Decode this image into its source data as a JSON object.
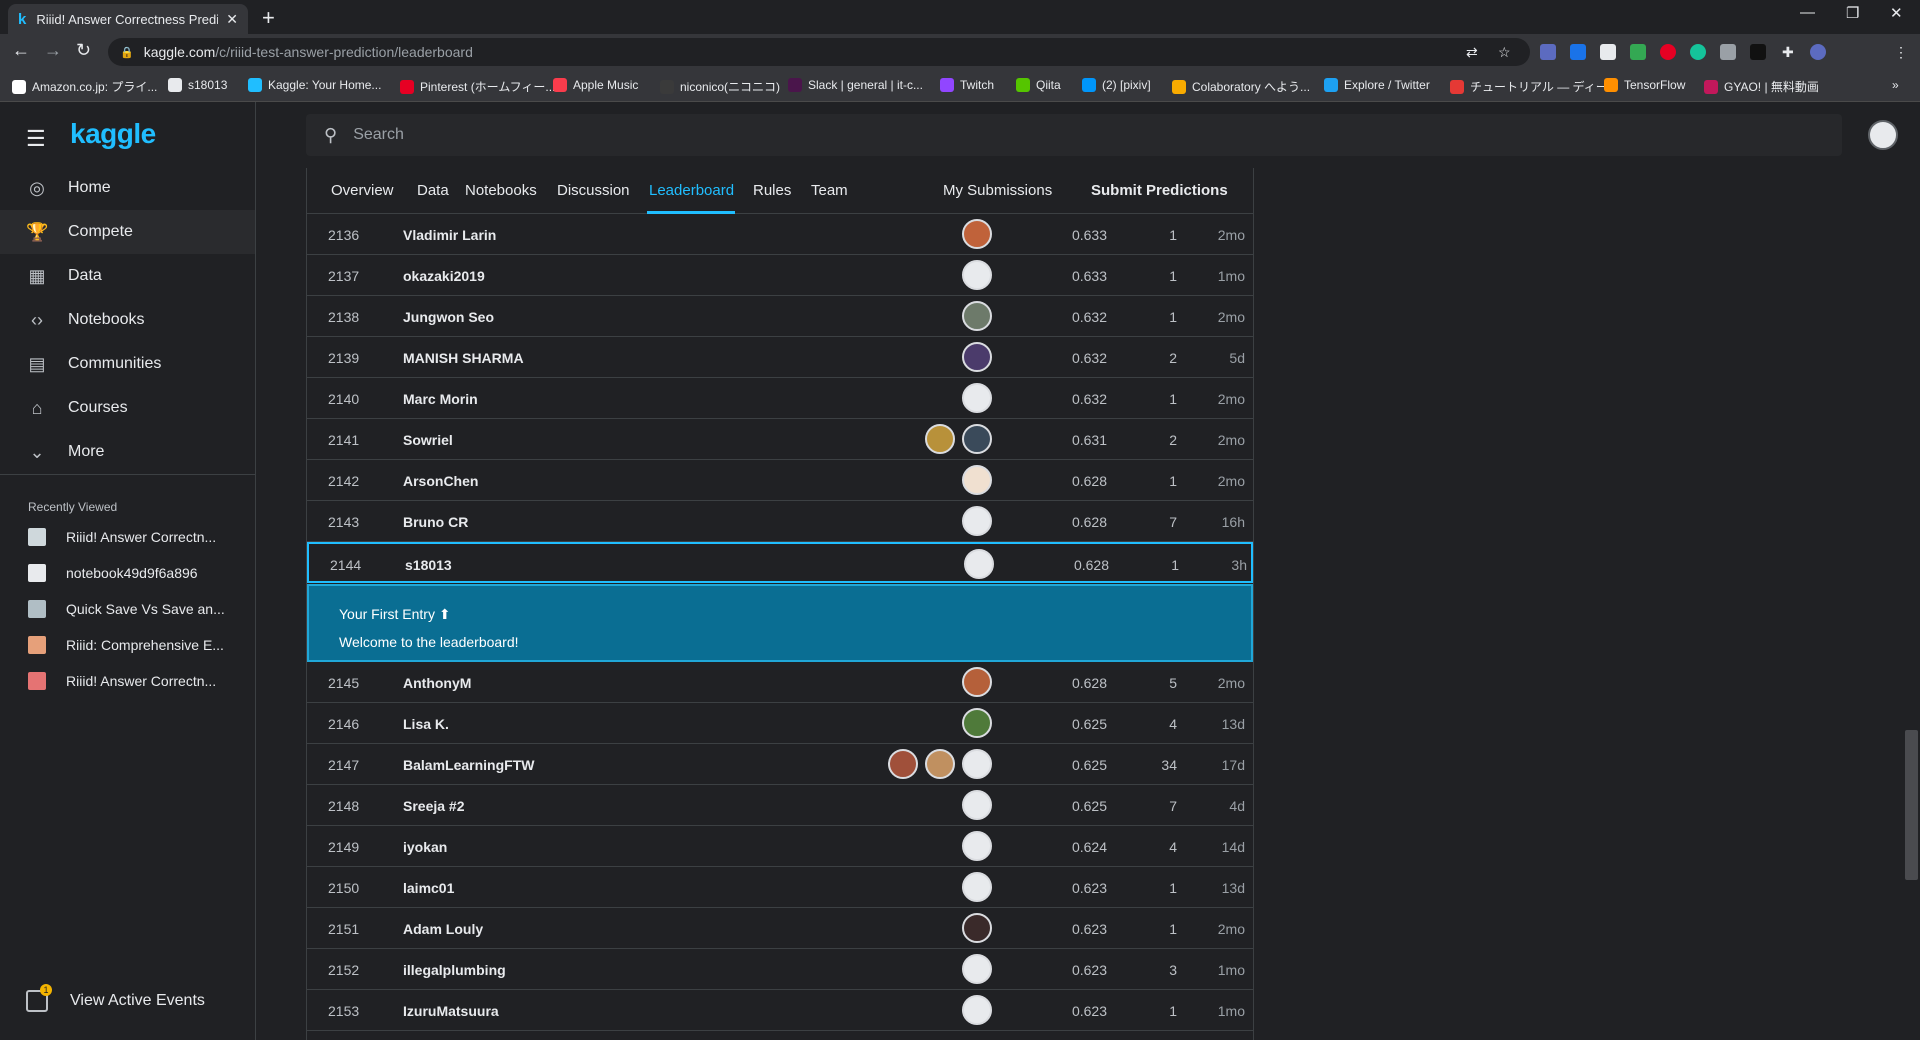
{
  "browser": {
    "tab_title": "Riiid! Answer Correctness Predicti",
    "tab_favicon": "k",
    "url_host": "kaggle.com",
    "url_path": "/c/riiid-test-answer-prediction/leaderboard",
    "bookmarks": [
      {
        "label": "Amazon.co.jp: プライ...",
        "color": "#ffffff"
      },
      {
        "label": "s18013",
        "color": "#e8eaed"
      },
      {
        "label": "Kaggle: Your Home...",
        "color": "#20beff"
      },
      {
        "label": "Pinterest (ホームフィー...",
        "color": "#e60023"
      },
      {
        "label": "Apple Music",
        "color": "#fa3c4c"
      },
      {
        "label": "niconico(ニコニコ)",
        "color": "#3a3a3a"
      },
      {
        "label": "Slack | general | it-c...",
        "color": "#4a154b"
      },
      {
        "label": "Twitch",
        "color": "#9146ff"
      },
      {
        "label": "Qiita",
        "color": "#55c500"
      },
      {
        "label": "(2) [pixiv]",
        "color": "#0096fa"
      },
      {
        "label": "Colaboratory へよう...",
        "color": "#f9ab00"
      },
      {
        "label": "Explore / Twitter",
        "color": "#1da1f2"
      },
      {
        "label": "チュートリアル — ディー...",
        "color": "#e53935"
      },
      {
        "label": "TensorFlow",
        "color": "#ff8f00"
      },
      {
        "label": "GYAO! | 無料動画",
        "color": "#c2185b"
      }
    ]
  },
  "sidebar": {
    "logo": "kaggle",
    "items": [
      {
        "label": "Home",
        "icon": "compass-icon",
        "glyph": "◎"
      },
      {
        "label": "Compete",
        "icon": "trophy-icon",
        "glyph": "🏆"
      },
      {
        "label": "Data",
        "icon": "table-icon",
        "glyph": "▦"
      },
      {
        "label": "Notebooks",
        "icon": "code-icon",
        "glyph": "‹›"
      },
      {
        "label": "Communities",
        "icon": "forum-icon",
        "glyph": "▤"
      },
      {
        "label": "Courses",
        "icon": "graduation-cap-icon",
        "glyph": "⌂"
      },
      {
        "label": "More",
        "icon": "chevron-down-icon",
        "glyph": "⌄"
      }
    ],
    "recently_viewed_title": "Recently Viewed",
    "recent": [
      {
        "label": "Riiid! Answer Correctn...",
        "color": "#cfd8dc"
      },
      {
        "label": "notebook49d9f6a896",
        "color": "#e8eaed"
      },
      {
        "label": "Quick Save Vs Save an...",
        "color": "#b0bec5"
      },
      {
        "label": "Riiid: Comprehensive E...",
        "color": "#e6a07a"
      },
      {
        "label": "Riiid! Answer Correctn...",
        "color": "#e57373"
      }
    ],
    "events_label": "View Active Events",
    "events_badge": "1"
  },
  "search": {
    "placeholder": "Search"
  },
  "competition_tabs": [
    "Overview",
    "Data",
    "Notebooks",
    "Discussion",
    "Leaderboard",
    "Rules",
    "Team"
  ],
  "active_tab": "Leaderboard",
  "my_submissions": "My Submissions",
  "submit_predictions": "Submit Predictions",
  "leaderboard": {
    "rows_before": [
      {
        "rank": "2136",
        "team": "Vladimir Larin",
        "score": "0.633",
        "entries": "1",
        "last": "2mo",
        "avatars": [
          "#c0623a"
        ]
      },
      {
        "rank": "2137",
        "team": "okazaki2019",
        "score": "0.633",
        "entries": "1",
        "last": "1mo",
        "avatars": [
          "#e8eaed"
        ]
      },
      {
        "rank": "2138",
        "team": "Jungwon Seo",
        "score": "0.632",
        "entries": "1",
        "last": "2mo",
        "avatars": [
          "#6d7a6a"
        ]
      },
      {
        "rank": "2139",
        "team": "MANISH SHARMA",
        "score": "0.632",
        "entries": "2",
        "last": "5d",
        "avatars": [
          "#4b3b6b"
        ]
      },
      {
        "rank": "2140",
        "team": "Marc Morin",
        "score": "0.632",
        "entries": "1",
        "last": "2mo",
        "avatars": [
          "#e8eaed"
        ]
      },
      {
        "rank": "2141",
        "team": "Sowriel",
        "score": "0.631",
        "entries": "2",
        "last": "2mo",
        "avatars": [
          "#b8913a",
          "#3a4a5a"
        ]
      },
      {
        "rank": "2142",
        "team": "ArsonChen",
        "score": "0.628",
        "entries": "1",
        "last": "2mo",
        "avatars": [
          "#f0e0d0"
        ]
      },
      {
        "rank": "2143",
        "team": "Bruno CR",
        "score": "0.628",
        "entries": "7",
        "last": "16h",
        "avatars": [
          "#e8eaed"
        ]
      }
    ],
    "my_row": {
      "rank": "2144",
      "team": "s18013",
      "score": "0.628",
      "entries": "1",
      "last": "3h",
      "avatars": [
        "#e8eaed"
      ]
    },
    "banner_title": "Your First Entry ⬆",
    "banner_text": "Welcome to the leaderboard!",
    "rows_after": [
      {
        "rank": "2145",
        "team": "AnthonyM",
        "score": "0.628",
        "entries": "5",
        "last": "2mo",
        "avatars": [
          "#b5603a"
        ]
      },
      {
        "rank": "2146",
        "team": "Lisa K.",
        "score": "0.625",
        "entries": "4",
        "last": "13d",
        "avatars": [
          "#4f7a3a"
        ]
      },
      {
        "rank": "2147",
        "team": "BalamLearningFTW",
        "score": "0.625",
        "entries": "34",
        "last": "17d",
        "avatars": [
          "#a0503a",
          "#c09060",
          "#e8eaed"
        ]
      },
      {
        "rank": "2148",
        "team": "Sreeja #2",
        "score": "0.625",
        "entries": "7",
        "last": "4d",
        "avatars": [
          "#e8eaed"
        ]
      },
      {
        "rank": "2149",
        "team": "iyokan",
        "score": "0.624",
        "entries": "4",
        "last": "14d",
        "avatars": [
          "#e8eaed"
        ]
      },
      {
        "rank": "2150",
        "team": "laimc01",
        "score": "0.623",
        "entries": "1",
        "last": "13d",
        "avatars": [
          "#e8eaed"
        ]
      },
      {
        "rank": "2151",
        "team": "Adam Louly",
        "score": "0.623",
        "entries": "1",
        "last": "2mo",
        "avatars": [
          "#3a2a2a"
        ]
      },
      {
        "rank": "2152",
        "team": "illegalplumbing",
        "score": "0.623",
        "entries": "3",
        "last": "1mo",
        "avatars": [
          "#e8eaed"
        ]
      },
      {
        "rank": "2153",
        "team": "IzuruMatsuura",
        "score": "0.623",
        "entries": "1",
        "last": "1mo",
        "avatars": [
          "#e8eaed"
        ]
      }
    ]
  }
}
